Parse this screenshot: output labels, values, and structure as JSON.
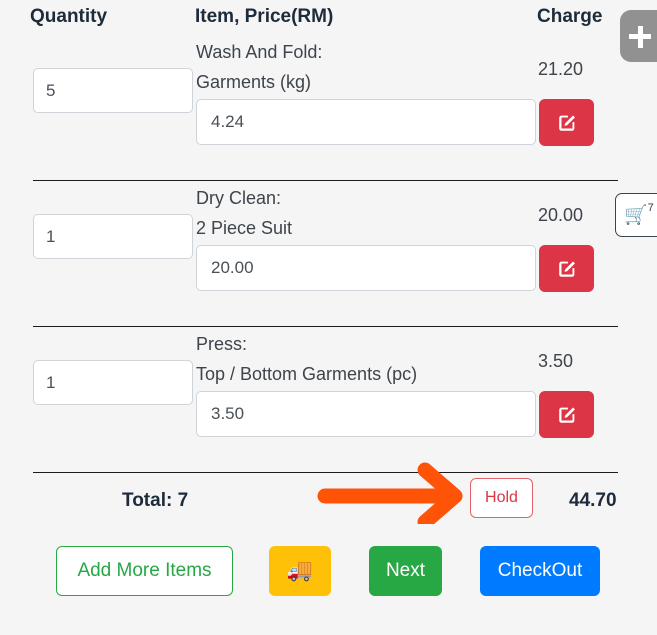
{
  "table": {
    "headers": {
      "quantity": "Quantity",
      "item_price": "Item, Price(RM)",
      "charge": "Charge"
    },
    "rows": [
      {
        "quantity": "5",
        "service": "Wash And Fold:",
        "item": "Garments (kg)",
        "price": "4.24",
        "charge": "21.20",
        "edit_icon": "edit-square-icon"
      },
      {
        "quantity": "1",
        "service": "Dry Clean:",
        "item": "2 Piece Suit",
        "price": "20.00",
        "charge": "20.00",
        "edit_icon": "edit-square-icon"
      },
      {
        "quantity": "1",
        "service": "Press:",
        "item": "Top / Bottom Garments (pc)",
        "price": "3.50",
        "charge": "3.50",
        "edit_icon": "edit-square-icon"
      }
    ]
  },
  "totals": {
    "total_label": "Total: 7",
    "hold_label": "Hold",
    "grand_total": "44.70"
  },
  "actions": {
    "add_more_label": "Add More Items",
    "delivery_icon": "🚚",
    "next_label": "Next",
    "checkout_label": "CheckOut"
  },
  "floating": {
    "add_icon": "plus-icon",
    "cart_icon": "shopping-cart-icon",
    "cart_count": "7"
  },
  "annotation": {
    "type": "arrow",
    "direction": "right",
    "color": "#FF5407",
    "points_to": "Hold"
  },
  "colors": {
    "background": "#f5f5f5",
    "danger": "#dc3545",
    "success": "#28a745",
    "primary": "#007bff",
    "warning": "#ffc107",
    "fab_gray": "#919191",
    "arrow_orange": "#FF5407"
  }
}
